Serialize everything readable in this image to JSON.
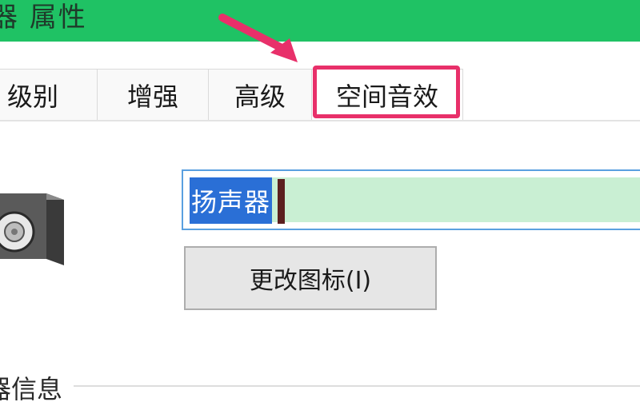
{
  "window": {
    "title": "器 属性"
  },
  "tabs": [
    {
      "label": "级别"
    },
    {
      "label": "增强"
    },
    {
      "label": "高级"
    },
    {
      "label": "空间音效"
    }
  ],
  "device": {
    "icon": "speaker-icon",
    "name_value": "扬声器",
    "change_icon_label": "更改图标(I)"
  },
  "section": {
    "label": "器信息"
  },
  "colors": {
    "titlebar": "#1fc264",
    "highlight": "#e8306a",
    "selection": "#2a6fd6",
    "input_fill": "#c9efd3"
  }
}
